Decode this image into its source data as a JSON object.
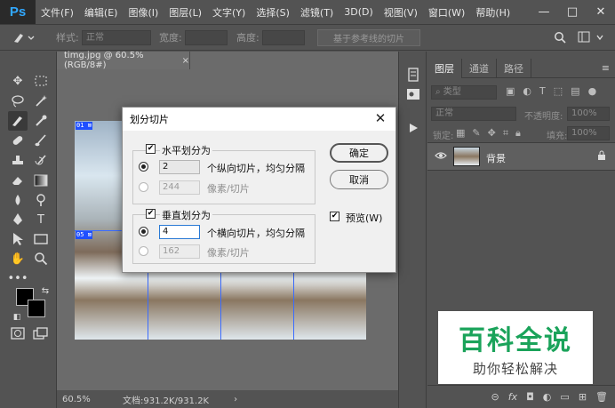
{
  "app": {
    "logo": "Ps"
  },
  "menu": [
    "文件(F)",
    "编辑(E)",
    "图像(I)",
    "图层(L)",
    "文字(Y)",
    "选择(S)",
    "滤镜(T)",
    "3D(D)",
    "视图(V)",
    "窗口(W)",
    "帮助(H)"
  ],
  "window_controls": {
    "minimize": "—",
    "restore": "□",
    "close": "✕"
  },
  "options_bar": {
    "style_label": "样式:",
    "style_value": "正常",
    "width_label": "宽度:",
    "height_label": "高度:",
    "slice_from_guides": "基于参考线的切片"
  },
  "document": {
    "tab_title": "timg.jpg @ 60.5%(RGB/8#)",
    "tab_close": "×",
    "zoom": "60.5%",
    "doc_info": "文档:931.2K/931.2K",
    "slice_tags": [
      "01",
      "05"
    ]
  },
  "dialog": {
    "title": "划分切片",
    "close": "✕",
    "horizontal": {
      "label": "水平划分为",
      "checked": true,
      "count_value": "2",
      "count_label": "个纵向切片，均匀分隔",
      "pixels_value": "244",
      "pixels_label": "像素/切片"
    },
    "vertical": {
      "label": "垂直划分为",
      "checked": true,
      "count_value": "4",
      "count_label": "个横向切片，均匀分隔",
      "pixels_value": "162",
      "pixels_label": "像素/切片"
    },
    "ok": "确定",
    "cancel": "取消",
    "preview_label": "预览(W)",
    "preview_checked": true
  },
  "layers_panel": {
    "tabs": [
      "图层",
      "通道",
      "路径"
    ],
    "filter_kind": "类型",
    "blend_mode": "正常",
    "opacity_label": "不透明度:",
    "opacity_value": "100%",
    "lock_label": "锁定:",
    "fill_label": "填充:",
    "fill_value": "100%",
    "layer_name": "背景"
  },
  "watermark": {
    "title": "百科全说",
    "subtitle": "助你轻松解决"
  }
}
